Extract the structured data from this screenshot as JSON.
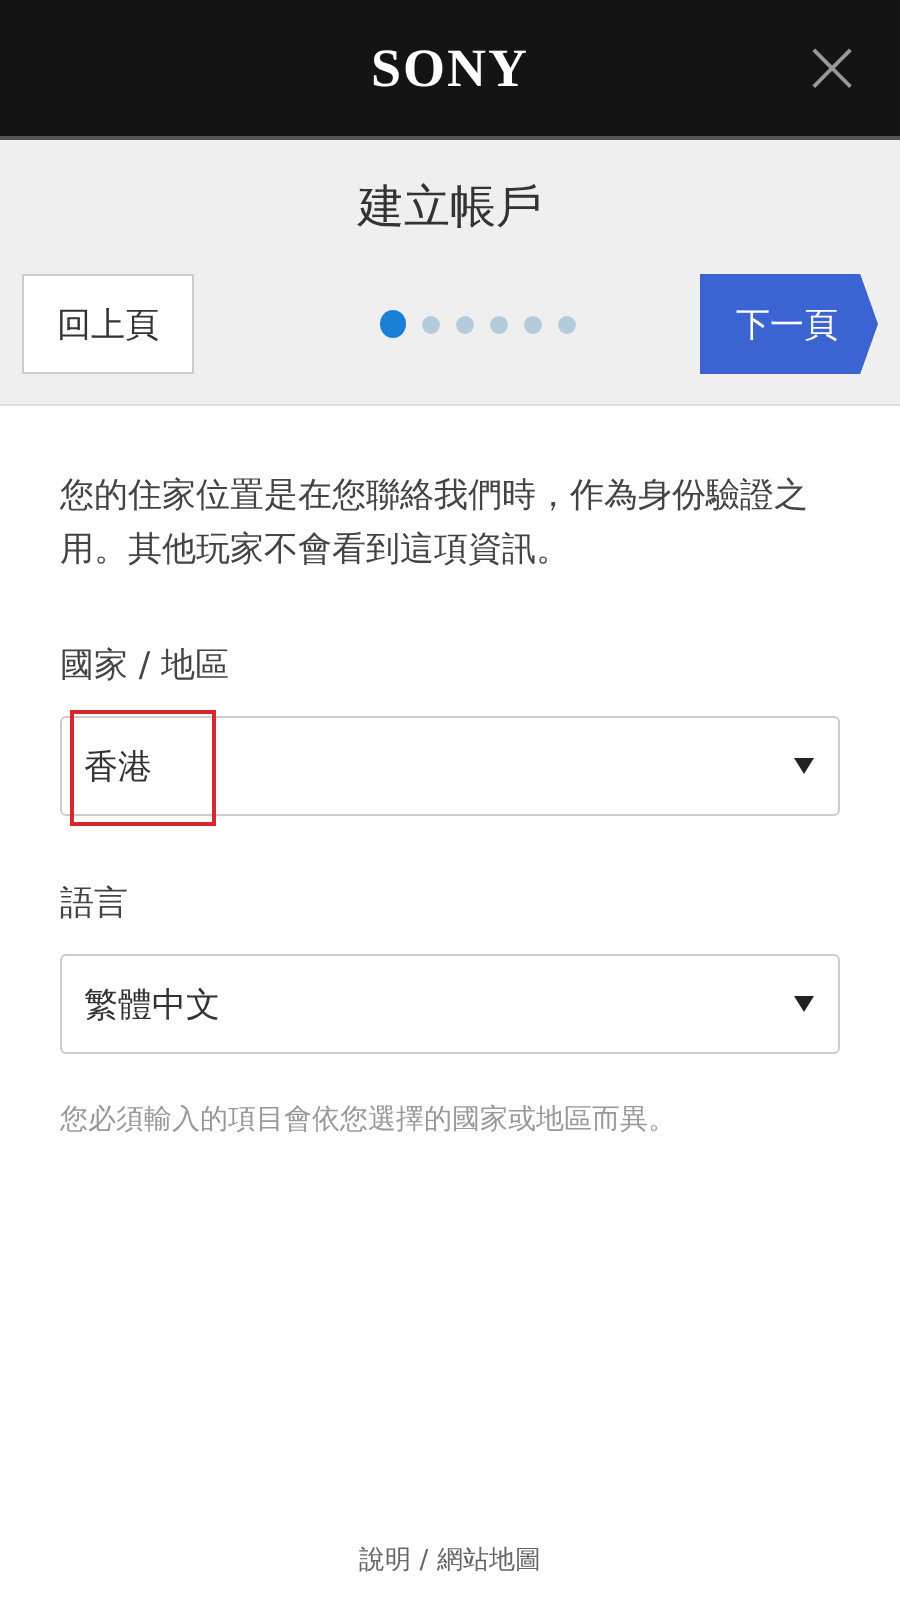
{
  "header": {
    "logo": "SONY",
    "close": "×"
  },
  "title": "建立帳戶",
  "nav": {
    "back": "回上頁",
    "next": "下一頁"
  },
  "steps": [
    {
      "selected": true
    },
    {
      "selected": false
    },
    {
      "selected": false
    },
    {
      "selected": false
    },
    {
      "selected": false
    },
    {
      "selected": false
    }
  ],
  "intro": "您的住家位置是在您聯絡我們時，作為身份驗證之用。其他玩家不會看到這項資訊。",
  "fields": [
    {
      "label": "國家 / 地區",
      "value": "香港",
      "highlighted": true
    },
    {
      "label": "語言",
      "value": "繁體中文",
      "highlighted": false
    }
  ],
  "hint": "您必須輸入的項目會依您選擇的國家或地區而異。",
  "footer": "說明 / 網站地圖"
}
